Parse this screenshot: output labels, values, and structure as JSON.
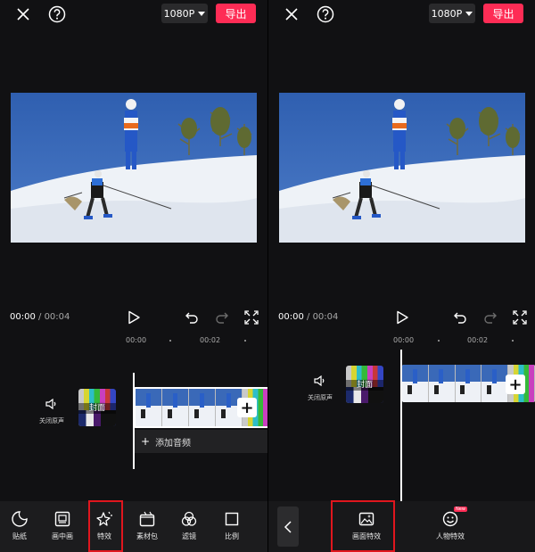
{
  "left": {
    "topbar": {
      "resolution": "1080P",
      "export_label": "导出"
    },
    "player": {
      "current_time": "00:00",
      "separator": " / ",
      "total_time": "00:04"
    },
    "timeline": {
      "ruler": [
        "00:00",
        "00:02"
      ],
      "mute_label": "关闭原声",
      "cover_label": "封面",
      "add_audio_label": "添加音频"
    },
    "toolbar": {
      "items": [
        {
          "label": "贴纸",
          "icon": "sticker-icon"
        },
        {
          "label": "画中画",
          "icon": "pip-icon"
        },
        {
          "label": "特效",
          "icon": "effects-icon",
          "highlighted": true
        },
        {
          "label": "素材包",
          "icon": "material-pack-icon"
        },
        {
          "label": "滤镜",
          "icon": "filter-icon"
        },
        {
          "label": "比例",
          "icon": "ratio-icon"
        }
      ]
    }
  },
  "right": {
    "topbar": {
      "resolution": "1080P",
      "export_label": "导出"
    },
    "player": {
      "current_time": "00:00",
      "separator": " / ",
      "total_time": "00:04"
    },
    "timeline": {
      "ruler": [
        "00:00",
        "00:02"
      ],
      "mute_label": "关闭原声",
      "cover_label": "封面"
    },
    "effects_menu": {
      "items": [
        {
          "label": "画面特效",
          "icon": "scene-effect-icon",
          "highlighted": true
        },
        {
          "label": "人物特效",
          "icon": "person-effect-icon",
          "badge": "New"
        }
      ]
    }
  },
  "colors": {
    "accent": "#fe2c55",
    "highlight_box": "#e0161e",
    "background": "#111113"
  }
}
